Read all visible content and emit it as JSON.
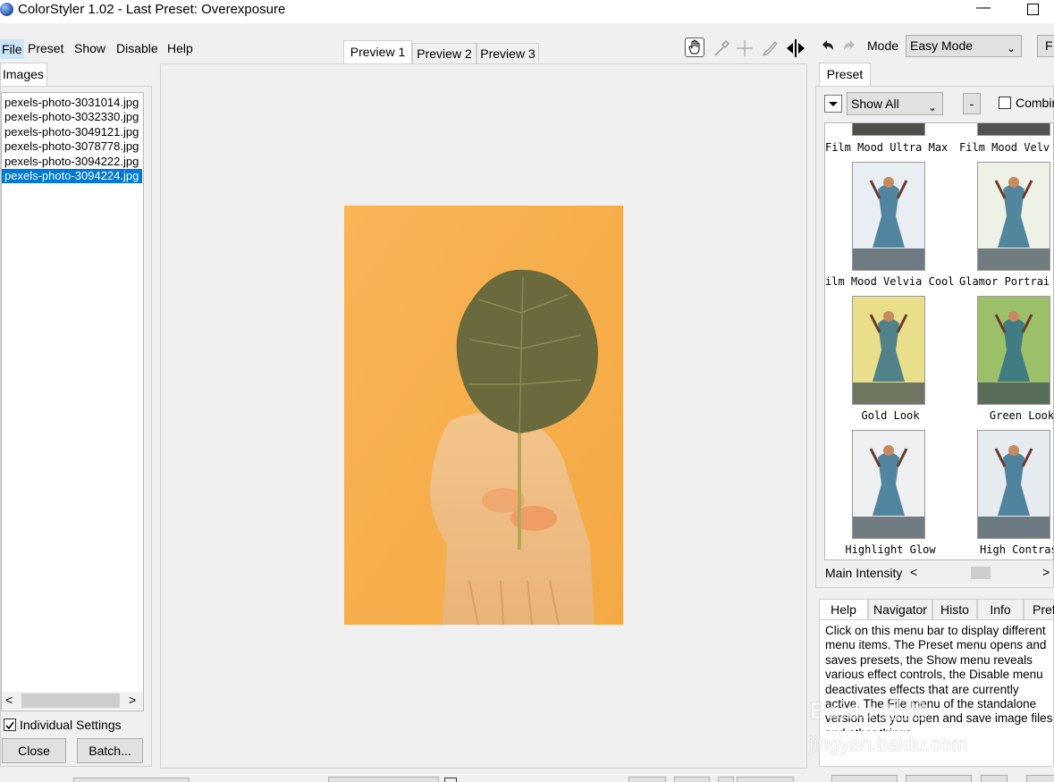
{
  "window": {
    "title": "ColorStyler 1.02 - Last Preset: Overexposure",
    "min_glyph": "—"
  },
  "menu": [
    "File",
    "Preset",
    "Show",
    "Disable",
    "Help"
  ],
  "preview_tabs": [
    "Preview 1",
    "Preview 2",
    "Preview 3"
  ],
  "images_tab": "Images",
  "files": [
    "pexels-photo-3031014.jpg",
    "pexels-photo-3032330.jpg",
    "pexels-photo-3049121.jpg",
    "pexels-photo-3078778.jpg",
    "pexels-photo-3094222.jpg",
    "pexels-photo-3094224.jpg"
  ],
  "selected_file_index": 5,
  "individual_settings": {
    "label": "Individual Settings",
    "checked": true
  },
  "buttons": {
    "close": "Close",
    "batch": "Batch..."
  },
  "mode": {
    "label": "Mode",
    "value": "Easy Mode",
    "partial_button": "F"
  },
  "preset_panel": {
    "tab": "Preset",
    "show_all": "Show All",
    "minus": "-",
    "combine": "Combin",
    "labels": [
      [
        "Film Mood Ultra Max",
        "Film Mood Velv"
      ],
      [
        "ilm Mood Velvia Cool",
        "Glamor Portrai"
      ],
      [
        "Gold Look",
        "Green Look"
      ],
      [
        "Highlight Glow",
        "High Contrast"
      ]
    ],
    "main_intensity": "Main Intensity"
  },
  "help_tabs": [
    "Help",
    "Navigator",
    "Histo",
    "Info",
    "Pref"
  ],
  "help_text": "Click on this menu bar to display different menu items. The Preset menu opens and saves presets, the Show menu reveals various effect controls, the Disable menu deactivates effects that are currently active. The File menu of the standalone version lets you open and save image files and other things.",
  "watermark": {
    "logo": "Baidu 经验",
    "url": "jingyan.baidu.com"
  },
  "colors": {
    "accent": "#0078d7",
    "photo_bg": "#f6b04f",
    "leaf": "#6b6a3c"
  }
}
